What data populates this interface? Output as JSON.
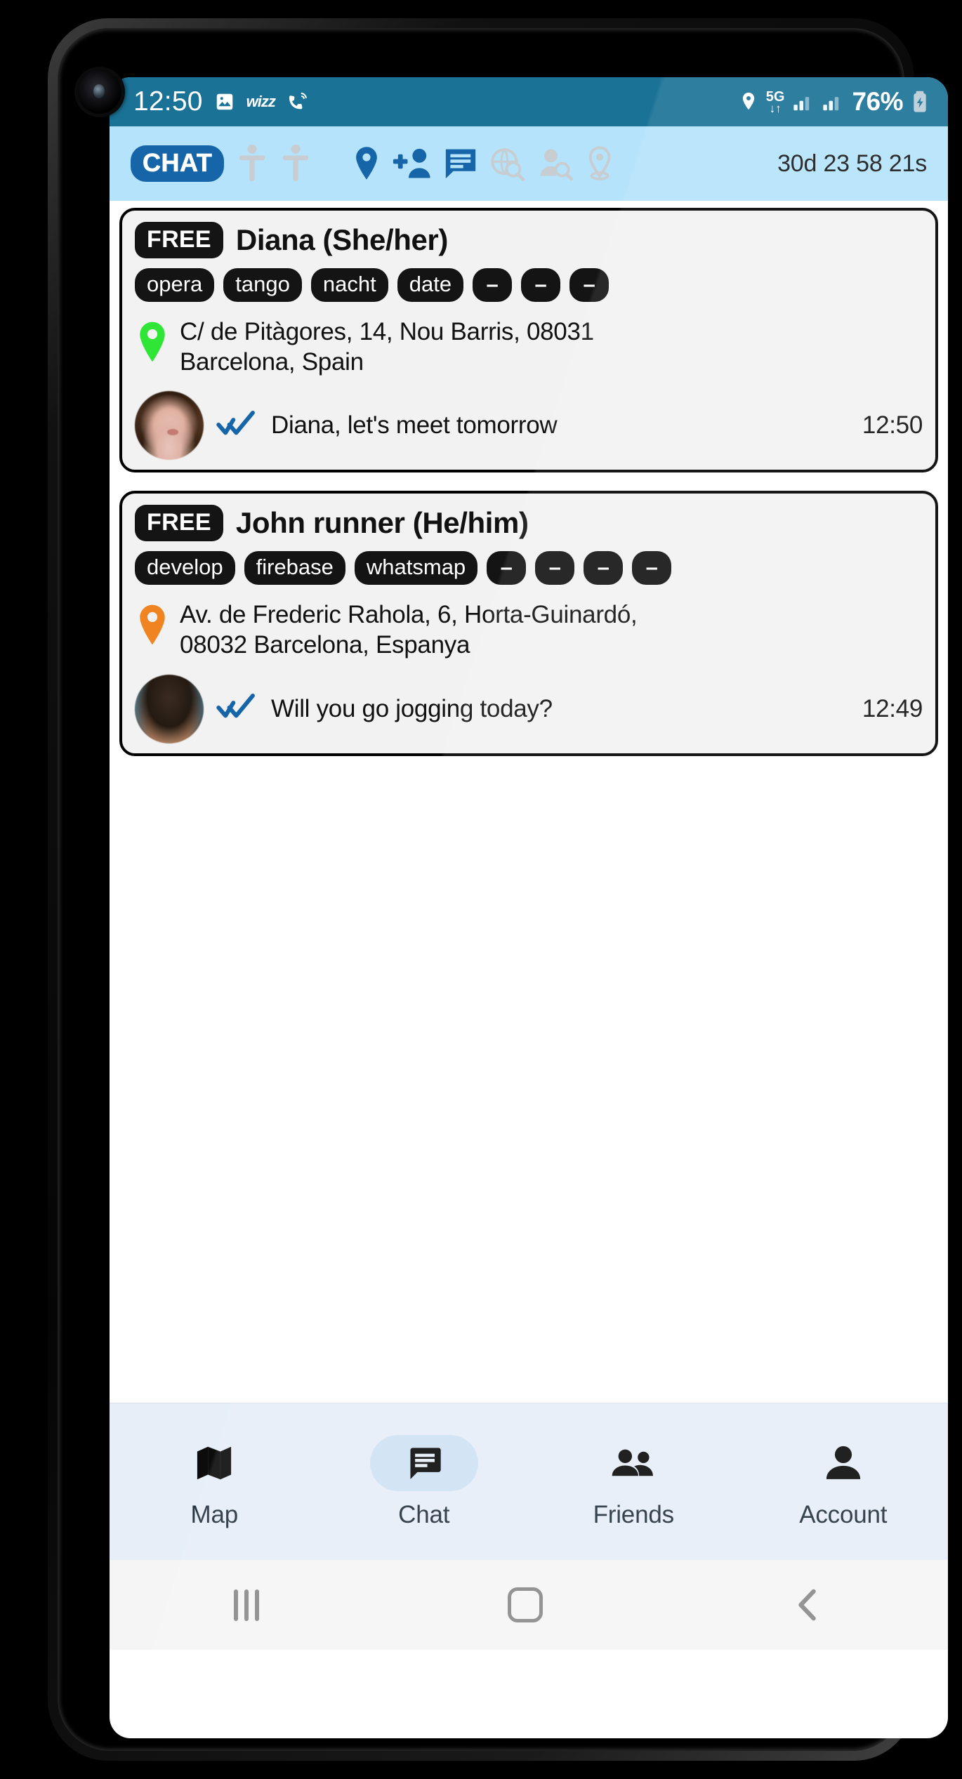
{
  "status_bar": {
    "time": "12:50",
    "battery": "76%",
    "network_gen": "5G",
    "icons": [
      "image-icon",
      "wizz-icon",
      "call-wifi-icon",
      "location-icon",
      "signal-icon",
      "signal-icon",
      "battery-charging-icon"
    ],
    "carrier_label": "wizz",
    "bg_color": "#1a7296"
  },
  "toolbar": {
    "mode_label": "CHAT",
    "timer": "30d 23 58 21s",
    "icons": [
      {
        "name": "male-figure-icon",
        "enabled": false
      },
      {
        "name": "female-figure-icon",
        "enabled": false
      },
      {
        "name": "map-pin-icon",
        "enabled": true
      },
      {
        "name": "add-person-icon",
        "enabled": true
      },
      {
        "name": "chat-bubble-icon",
        "enabled": true
      },
      {
        "name": "globe-search-icon",
        "enabled": false
      },
      {
        "name": "person-search-icon",
        "enabled": false
      },
      {
        "name": "pin-search-icon",
        "enabled": false
      }
    ],
    "bg_color": "#b5e3fb",
    "accent_color": "#1565a8"
  },
  "cards": [
    {
      "badge": "FREE",
      "name": "Diana (She/her)",
      "tags": [
        "opera",
        "tango",
        "nacht",
        "date"
      ],
      "empty_tags": [
        "–",
        "–",
        "–"
      ],
      "address_line1": "C/ de Pitàgores, 14, Nou Barris, 08031",
      "address_line2": "Barcelona, Spain",
      "pin_color": "#2fe636",
      "avatar": "diana-avatar",
      "message": "Diana, let's meet tomorrow",
      "time": "12:50",
      "read_status": "double-check-read"
    },
    {
      "badge": "FREE",
      "name": "John runner (He/him)",
      "tags": [
        "develop",
        "firebase",
        "whatsmap"
      ],
      "empty_tags": [
        "–",
        "–",
        "–",
        "–"
      ],
      "address_line1": "Av. de Frederic Rahola, 6, Horta-Guinardó,",
      "address_line2": "08032 Barcelona, Espanya",
      "pin_color": "#ef8420",
      "avatar": "john-avatar",
      "message": "Will you go jogging today?",
      "time": "12:49",
      "read_status": "double-check-read"
    }
  ],
  "bottom_nav": {
    "items": [
      {
        "label": "Map",
        "icon": "map-icon",
        "active": false
      },
      {
        "label": "Chat",
        "icon": "chat-bubble-icon",
        "active": true
      },
      {
        "label": "Friends",
        "icon": "people-icon",
        "active": false
      },
      {
        "label": "Account",
        "icon": "person-icon",
        "active": false
      }
    ],
    "bg_color": "#e6eef7",
    "active_pill_color": "#cfe1f3"
  },
  "system_nav": {
    "recents": "recents-icon",
    "home": "home-icon",
    "back": "back-icon"
  }
}
